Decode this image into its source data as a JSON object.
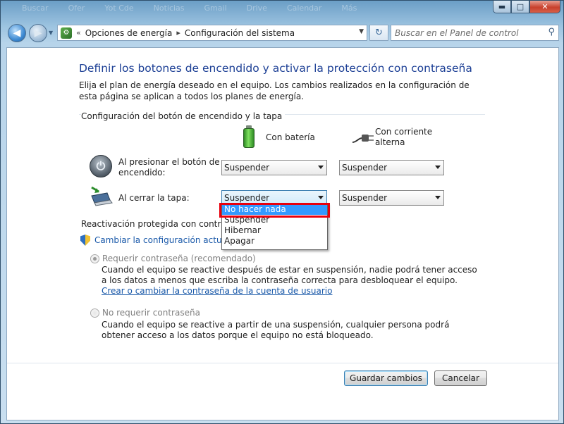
{
  "window": {
    "bg_taskbar_ghost": [
      "Buscar",
      "Ofer",
      "Yot Cde",
      "Noticias",
      "Gmail",
      "Drive",
      "Calendar",
      "Más"
    ],
    "minimize": "▬",
    "maximize": "□",
    "close": "✕"
  },
  "nav": {
    "back": "◀",
    "forward": "▶",
    "history_arrow": "▼",
    "breadcrumb_prefix": "«",
    "breadcrumbs": [
      "Opciones de energía",
      "Configuración del sistema"
    ],
    "breadcrumb_separator": "▸",
    "address_dropdown": "▼",
    "refresh": "↻",
    "search_placeholder": "Buscar en el Panel de control",
    "search_icon_glyph": "⚲"
  },
  "page": {
    "title": "Definir los botones de encendido y activar la protección con contraseña",
    "intro": "Elija el plan de energía deseado en el equipo. Los cambios realizados en la configuración de esta página se aplican a todos los planes de energía.",
    "section_power": "Configuración del botón de encendido y la tapa",
    "col_battery": "Con batería",
    "col_ac_line1": "Con corriente",
    "col_ac_line2": "alterna",
    "row_power_line1": "Al presionar el botón de",
    "row_power_line2": "encendido:",
    "row_lid": "Al cerrar la tapa:",
    "power_battery_value": "Suspender",
    "power_ac_value": "Suspender",
    "lid_battery_value": "Suspender",
    "lid_ac_value": "Suspender",
    "dropdown_options": [
      "No hacer nada",
      "Suspender",
      "Hibernar",
      "Apagar"
    ],
    "dropdown_selected": "No hacer nada",
    "section_wake": "Reactivación protegida con contraseña",
    "change_settings_link": "Cambiar la configuración actualm",
    "require_password_label": "Requerir contraseña (recomendado)",
    "require_desc_text": "Cuando el equipo se reactive después de estar en suspensión, nadie podrá tener acceso a los datos a menos que escriba la contraseña correcta para desbloquear el equipo. ",
    "require_desc_link": "Crear o cambiar la contraseña de la cuenta de usuario",
    "no_password_label": "No requerir contraseña",
    "no_password_desc": "Cuando el equipo se reactive a partir de una suspensión, cualquier persona podrá obtener acceso a los datos porque el equipo no está bloqueado.",
    "save_button": "Guardar cambios",
    "cancel_button": "Cancelar"
  },
  "colors": {
    "title_blue": "#1c3f95",
    "link_blue": "#1a59a9",
    "dropdown_highlight": "#3399ff",
    "annotation_red": "#e8000d"
  }
}
